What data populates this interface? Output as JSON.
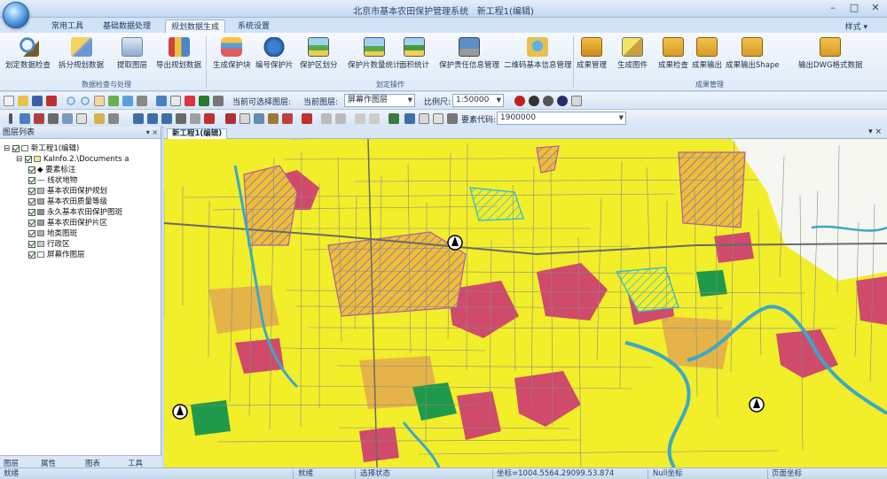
{
  "title": {
    "app_title": "北京市基本农田保护管理系统",
    "doc_title": "新工程1(编辑)"
  },
  "window_controls": {
    "minimize": "–",
    "maximize": "□",
    "close": "✕"
  },
  "tabs": [
    "常用工具",
    "基础数据处理",
    "规划数据生成",
    "系统设置"
  ],
  "active_tab_index": 2,
  "style_menu": "样式",
  "ribbon": {
    "groups": [
      {
        "label": "数据检查与处理",
        "buttons": [
          "划定数据检查",
          "拆分规划数据",
          "提取图层",
          "导出规划数据"
        ]
      },
      {
        "label": "划定操作",
        "buttons": [
          "生成保护块",
          "编号保护片",
          "保护区划分",
          "保护片数量统计",
          "面积统计",
          "保护责任信息管理",
          "二维码基本信息管理"
        ]
      },
      {
        "label": "成果管理",
        "buttons": [
          "成果管理",
          "生成图件",
          "成果检查",
          "成果输出",
          "成果输出Shape",
          "输出DWG格式数据"
        ]
      }
    ]
  },
  "toolbar1": {
    "selectable_layer_label": "当前可选择图层:",
    "selectable_layer_value": "",
    "current_layer_label": "当前图层:",
    "current_layer_value": "屏幕作图层",
    "scale_label": "比例尺:",
    "scale_value": "1:50000"
  },
  "toolbar2": {
    "element_code_label": "要素代码:",
    "element_code_value": "1900000"
  },
  "left_panel": {
    "title": "图层列表",
    "pin": "▾ ×",
    "tree": [
      {
        "label": "新工程1(编辑)",
        "level": 0,
        "checked": true,
        "swatch": "#ffffff"
      },
      {
        "label": "KaInfo.2.\\Documents a",
        "level": 1,
        "checked": true,
        "swatch": "#f0e68c"
      },
      {
        "label": "◆ 要素标注",
        "level": 2,
        "checked": true,
        "swatch": ""
      },
      {
        "label": "— 线状地物",
        "level": 2,
        "checked": true,
        "swatch": ""
      },
      {
        "label": "基本农田保护规划",
        "level": 2,
        "checked": true,
        "swatch": "#b8b8b8"
      },
      {
        "label": "基本农田质量等级",
        "level": 2,
        "checked": true,
        "swatch": "#a0a0a0"
      },
      {
        "label": "永久基本农田保护图斑",
        "level": 2,
        "checked": true,
        "swatch": "#8f8f8f"
      },
      {
        "label": "基本农田保护片区",
        "level": 2,
        "checked": true,
        "swatch": "#9a9a9a"
      },
      {
        "label": "地类图斑",
        "level": 2,
        "checked": true,
        "swatch": "#b0b0b0"
      },
      {
        "label": "行政区",
        "level": 2,
        "checked": true,
        "swatch": "#c8c8c8"
      },
      {
        "label": "屏幕作图层",
        "level": 2,
        "checked": true,
        "swatch": "#ffffff"
      }
    ],
    "bottom_tabs": [
      "图层",
      "属性",
      "图表",
      "工具"
    ]
  },
  "document_tab": "新工程1(编辑)",
  "statusbar": {
    "ready": "就绪",
    "field2": "就绪",
    "field3": "选择状态",
    "coords": "坐标=1004.5564.29099.53.874",
    "coord_system": "Null坐标",
    "page": "页面坐标"
  },
  "map_colors": {
    "farmland": "#f2ee2a",
    "construction": "#cf4a6b",
    "water": "#3aa8c8",
    "forest": "#1f9a4a",
    "orchard": "#e5b347",
    "boundary": "#8a8a8a",
    "hatch": "#b05aa5",
    "zone": "#35c0c8"
  }
}
